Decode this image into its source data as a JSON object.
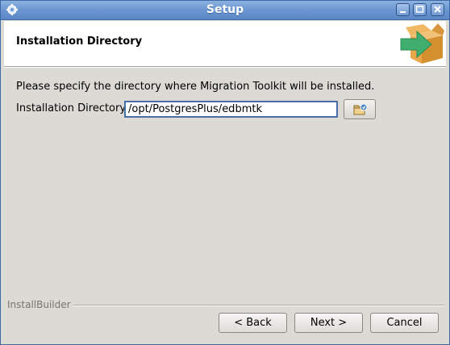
{
  "window": {
    "title": "Setup"
  },
  "header": {
    "heading": "Installation Directory"
  },
  "main": {
    "instructions": "Please specify the directory where Migration Toolkit will be installed.",
    "directory_label": "Installation Directory",
    "directory_value": "/opt/PostgresPlus/edbmtk"
  },
  "footer": {
    "brand": "InstallBuilder",
    "back_label": "< Back",
    "next_label": "Next >",
    "cancel_label": "Cancel"
  },
  "colors": {
    "titlebar": "#6d98d2",
    "box_orange": "#e8a74a",
    "arrow_green": "#3fae6e"
  }
}
